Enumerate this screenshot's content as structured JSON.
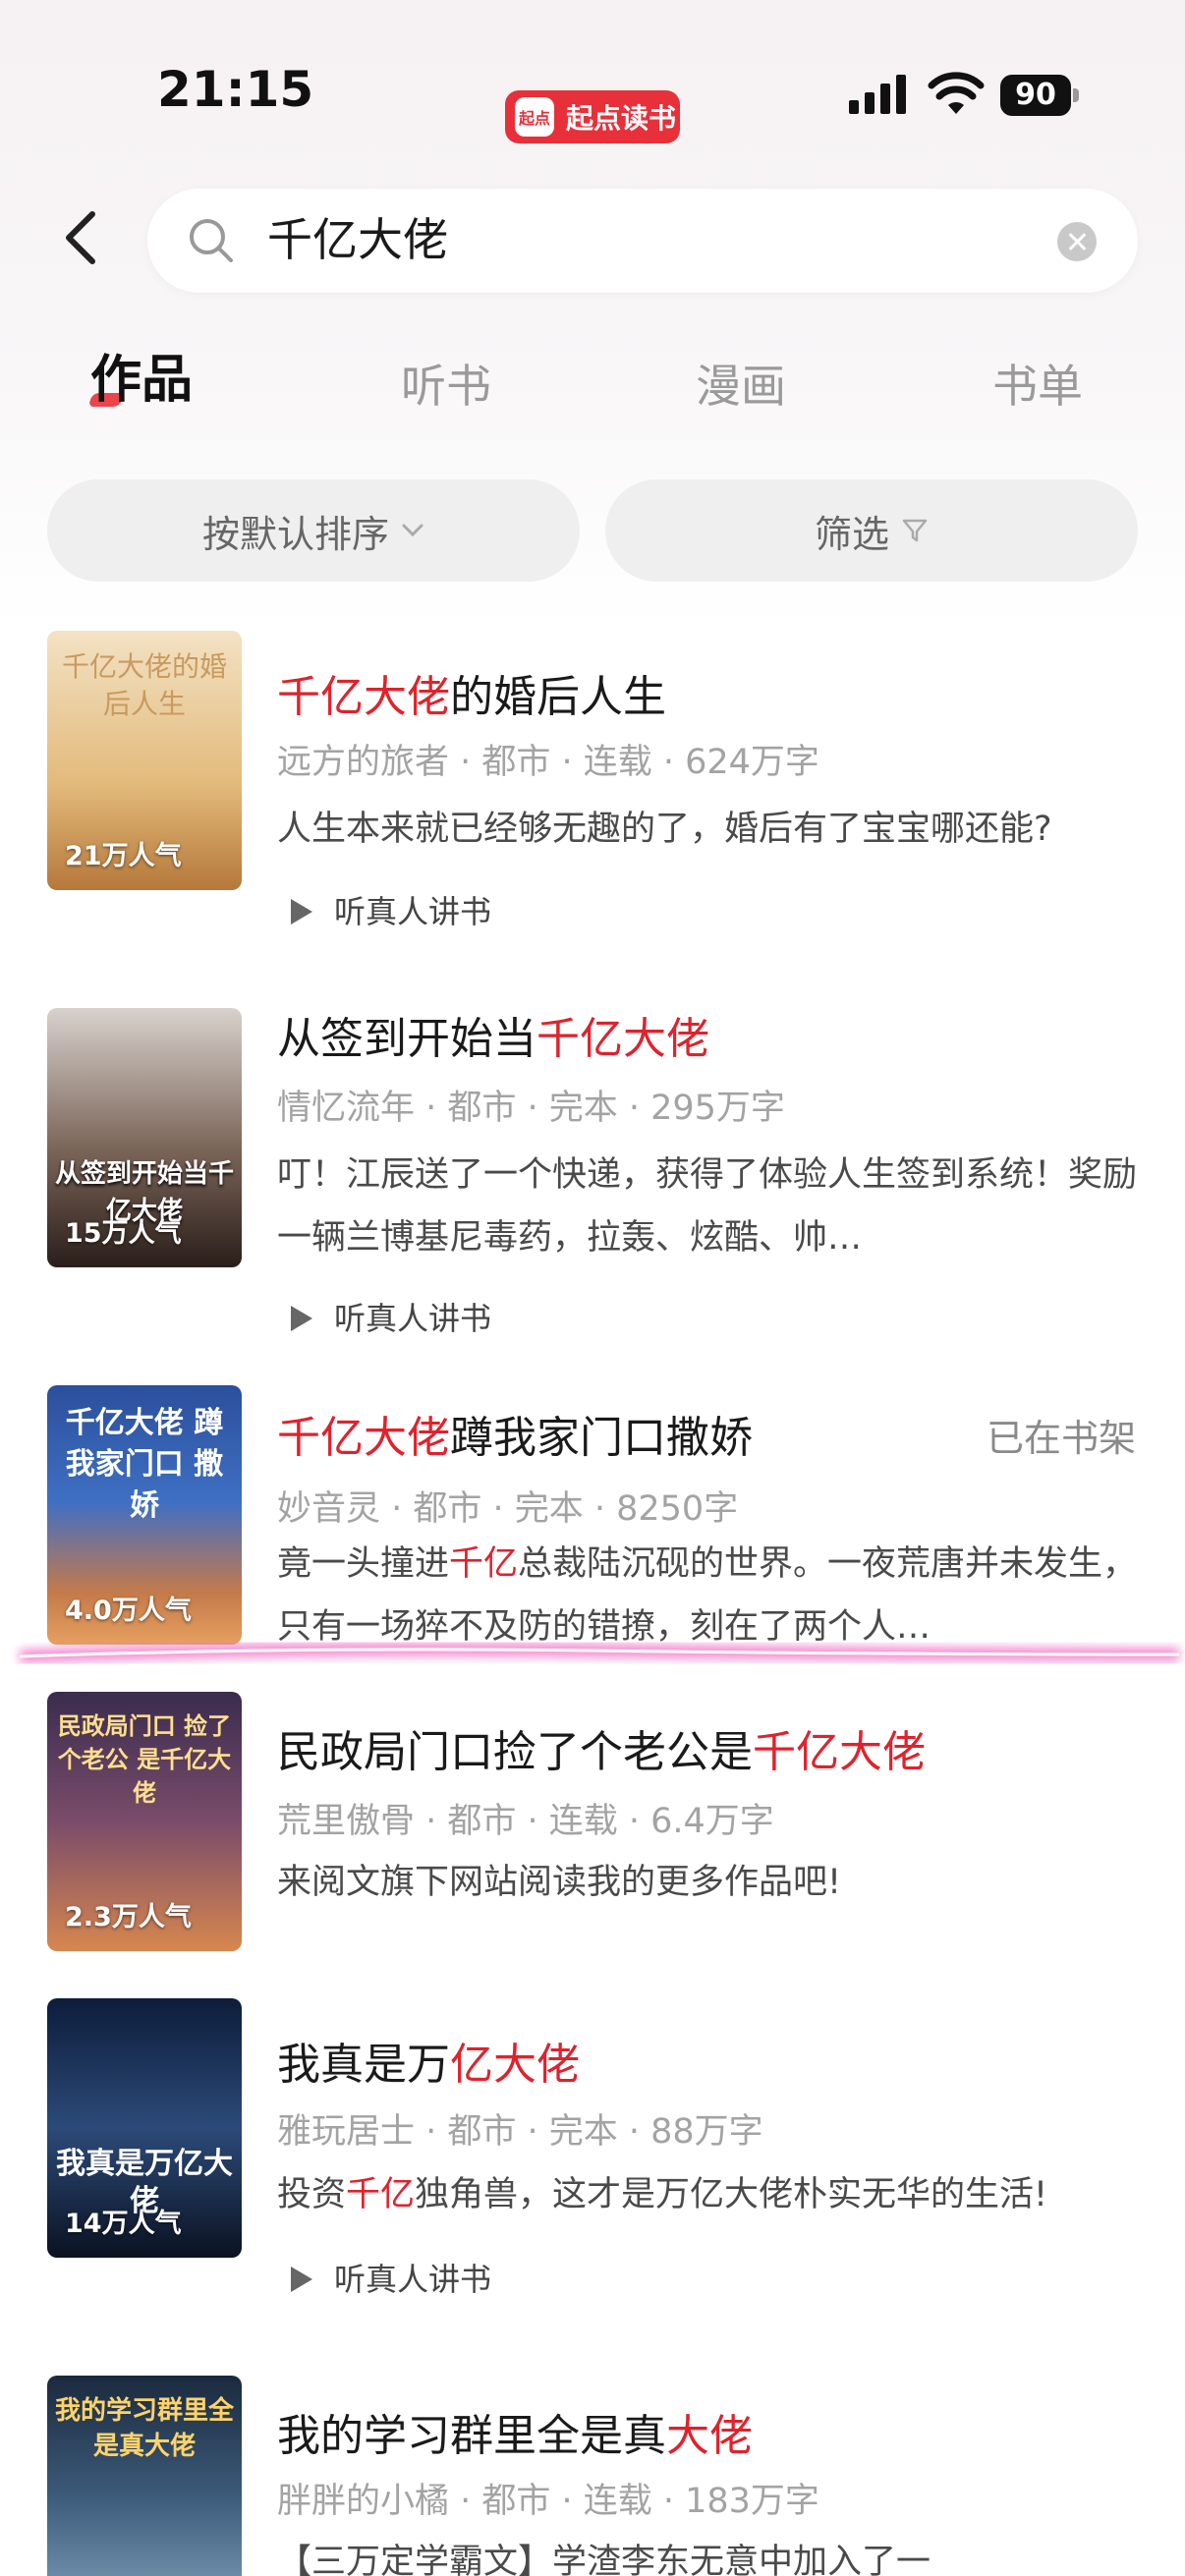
{
  "status": {
    "time": "21:15",
    "battery": "90",
    "app_badge_logo": "起点",
    "app_badge_name": "起点读书"
  },
  "search": {
    "query": "千亿大佬"
  },
  "tabs": [
    {
      "label": "作品",
      "active": true
    },
    {
      "label": "听书"
    },
    {
      "label": "漫画"
    },
    {
      "label": "书单"
    }
  ],
  "filters": {
    "sort_label": "按默认排序",
    "filter_label": "筛选"
  },
  "books": [
    {
      "title_pre": "",
      "title_hl": "千亿大佬",
      "title_post": "的婚后人生",
      "meta": "远方的旅者 · 都市 · 连载 · 624万字",
      "desc": "人生本来就已经够无趣的了，婚后有了宝宝哪还能?",
      "popularity": "21万人气",
      "cover_text": "千亿大佬的婚后人生",
      "audio": "听真人讲书"
    },
    {
      "title_pre": "从签到开始当",
      "title_hl": "千亿大佬",
      "title_post": "",
      "meta": "情忆流年 · 都市 · 完本 · 295万字",
      "desc": "叮！江辰送了一个快递，获得了体验人生签到系统！奖励一辆兰博基尼毒药，拉轰、炫酷、帅…",
      "popularity": "15万人气",
      "cover_text": "从签到开始当千亿大佬",
      "audio": "听真人讲书"
    },
    {
      "title_pre": "",
      "title_hl": "千亿大佬",
      "title_post": "蹲我家门口撒娇",
      "meta": "妙音灵 · 都市 · 完本 · 8250字",
      "desc_pre": "竟一头撞进",
      "desc_hl": "千亿",
      "desc_post": "总裁陆沉砚的世界。一夜荒唐并未发生，只有一场猝不及防的错撩，刻在了两个人…",
      "popularity": "4.0万人气",
      "cover_text": "千亿大佬 蹲我家门口 撒娇",
      "shelf": "已在书架"
    },
    {
      "title_pre": "民政局门口捡了个老公是",
      "title_hl": "千亿大佬",
      "title_post": "",
      "meta": "荒里傲骨 · 都市 · 连载 · 6.4万字",
      "desc": "来阅文旗下网站阅读我的更多作品吧!",
      "popularity": "2.3万人气",
      "cover_text": "民政局门口 捡了个老公 是千亿大佬"
    },
    {
      "title_pre": "我真是万",
      "title_hl": "亿大佬",
      "title_post": "",
      "meta": "雅玩居士 · 都市 · 完本 · 88万字",
      "desc_pre": "投资",
      "desc_hl": "千亿",
      "desc_post": "独角兽，这才是万亿大佬朴实无华的生活!",
      "popularity": "14万人气",
      "cover_text": "我真是万亿大佬",
      "audio": "听真人讲书"
    },
    {
      "title_pre": "我的学习群里全是真",
      "title_hl": "大佬",
      "title_post": "",
      "meta": "胖胖的小橘 · 都市 · 连载 · 183万字",
      "desc": "【三万定学霸文】学渣李东无意中加入了一",
      "cover_text": "我的学习群里全是真大佬"
    }
  ]
}
